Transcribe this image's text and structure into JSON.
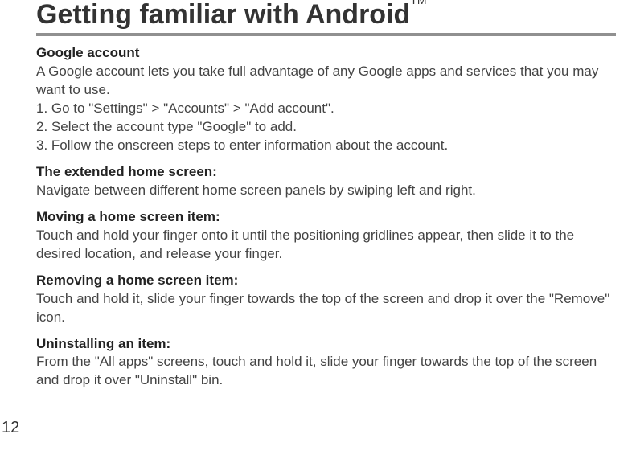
{
  "title_prefix": "Getting familiar with Android",
  "title_tm": "TM",
  "sections": {
    "google_account": {
      "heading": "Google account",
      "body": "A Google account lets you take full advantage of any Google apps and services that you may want to use.",
      "step1": "1. Go to \"Settings\" > \"Accounts\" > \"Add account\".",
      "step2": "2. Select the account type \"Google\" to add.",
      "step3": "3. Follow the onscreen steps to enter information about the account."
    },
    "extended_home": {
      "heading": "The extended home screen:",
      "body": "Navigate between different home screen panels by swiping left and right."
    },
    "moving_item": {
      "heading": "Moving a home screen item:",
      "body": "Touch and hold your finger onto it until the positioning gridlines appear, then slide it to the desired location, and release your finger."
    },
    "removing_item": {
      "heading": "Removing a home screen item:",
      "body": "Touch and hold it, slide your finger towards the top of the screen and drop it over the \"Remove\" icon."
    },
    "uninstalling_item": {
      "heading": "Uninstalling an item:",
      "body": "From the \"All apps\" screens, touch and hold it, slide your finger towards the top of the screen and drop it over \"Uninstall\" bin."
    }
  },
  "page_number": "12"
}
